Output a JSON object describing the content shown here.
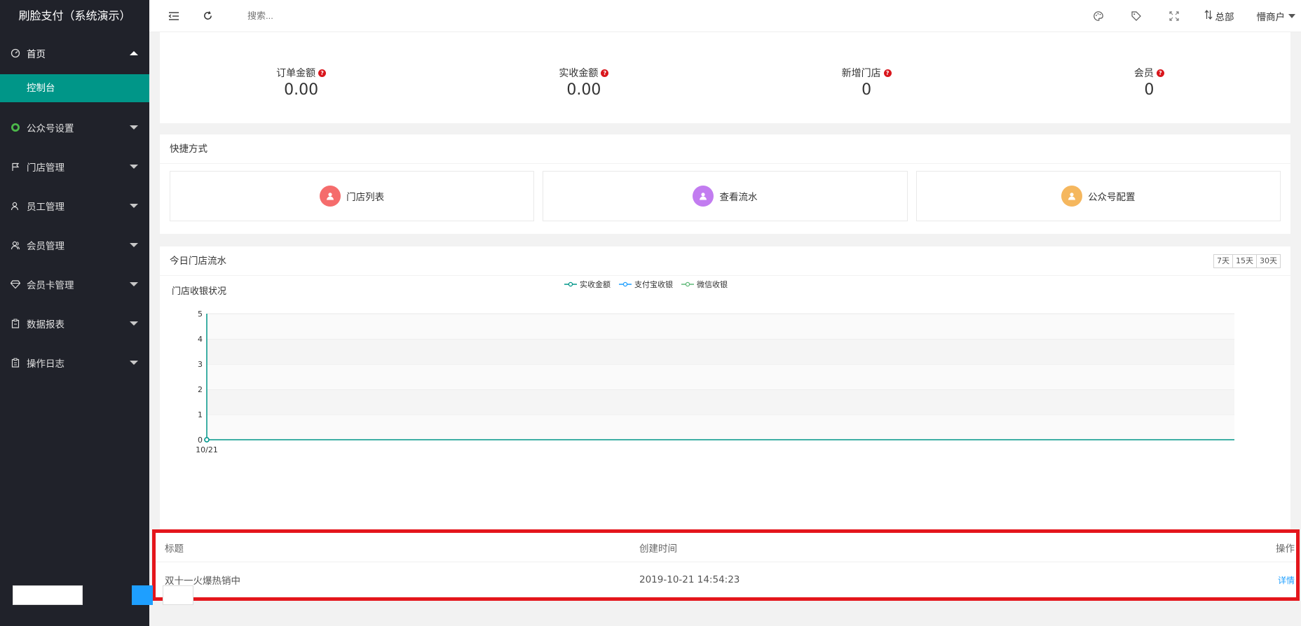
{
  "sidebar": {
    "brand": "刷脸支付（系统演示）",
    "home": "首页",
    "home_sub": "控制台",
    "items": [
      {
        "label": "公众号设置",
        "icon": "wechat-icon"
      },
      {
        "label": "门店管理",
        "icon": "flag-icon"
      },
      {
        "label": "员工管理",
        "icon": "user-icon"
      },
      {
        "label": "会员管理",
        "icon": "members-icon"
      },
      {
        "label": "会员卡管理",
        "icon": "diamond-icon"
      },
      {
        "label": "数据报表",
        "icon": "clipboard-icon"
      },
      {
        "label": "操作日志",
        "icon": "log-icon"
      }
    ]
  },
  "header": {
    "search_placeholder": "搜索...",
    "branch": "总部",
    "merchant": "懵商户"
  },
  "stats": [
    {
      "label": "订单金额",
      "value": "0.00"
    },
    {
      "label": "实收金额",
      "value": "0.00"
    },
    {
      "label": "新增门店",
      "value": "0"
    },
    {
      "label": "会员",
      "value": "0"
    }
  ],
  "shortcut": {
    "title": "快捷方式",
    "items": [
      {
        "label": "门店列表",
        "color": "#f56c6c"
      },
      {
        "label": "查看流水",
        "color": "#c27cf0"
      },
      {
        "label": "公众号配置",
        "color": "#f5b75e"
      }
    ]
  },
  "flow": {
    "title": "今日门店流水",
    "ranges": [
      "7天",
      "15天",
      "30天"
    ]
  },
  "chart_data": {
    "type": "line",
    "title": "门店收银状况",
    "x": [
      "10/21"
    ],
    "series": [
      {
        "name": "实收金额",
        "values": [
          0
        ],
        "color": "#009688"
      },
      {
        "name": "支付宝收银",
        "values": [
          0
        ],
        "color": "#1e9fff"
      },
      {
        "name": "微信收银",
        "values": [
          0
        ],
        "color": "#5fb878"
      }
    ],
    "ylim": [
      0,
      5
    ],
    "yticks": [
      0,
      1,
      2,
      3,
      4,
      5
    ],
    "legend": "top-center",
    "grid": true
  },
  "notice": {
    "headers": [
      "标题",
      "创建时间",
      "操作"
    ],
    "rows": [
      {
        "title": "双十一火爆热销中",
        "time": "2019-10-21 14:54:23",
        "action": "详情"
      }
    ]
  }
}
